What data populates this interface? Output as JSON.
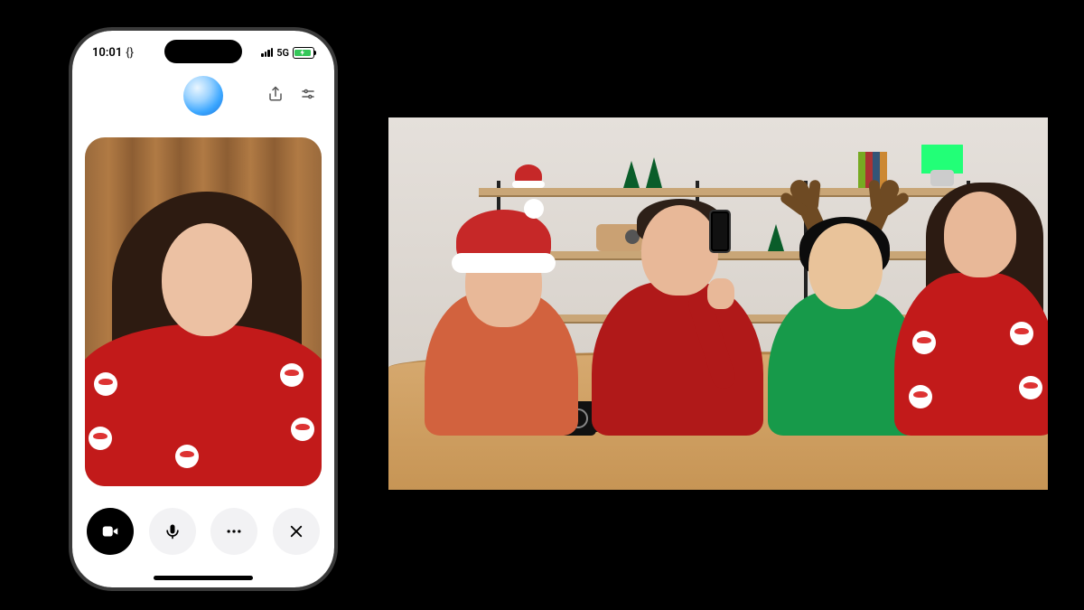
{
  "status_bar": {
    "time": "10:01",
    "time_suffix": "{}",
    "network_label": "5G"
  },
  "top_actions": {
    "share_icon": "share-icon",
    "settings_icon": "sliders-icon"
  },
  "avatar": {
    "label": "assistant-avatar"
  },
  "camera": {
    "flip_label": "flip-camera"
  },
  "controls": {
    "video": "video",
    "mic": "mic",
    "more": "more",
    "close": "close"
  },
  "scene": {
    "description": "Four people in holiday sweaters seated at a wooden table in front of wall shelves with festive decorations; one holds a phone.",
    "mug_logo": "openai-logo"
  }
}
